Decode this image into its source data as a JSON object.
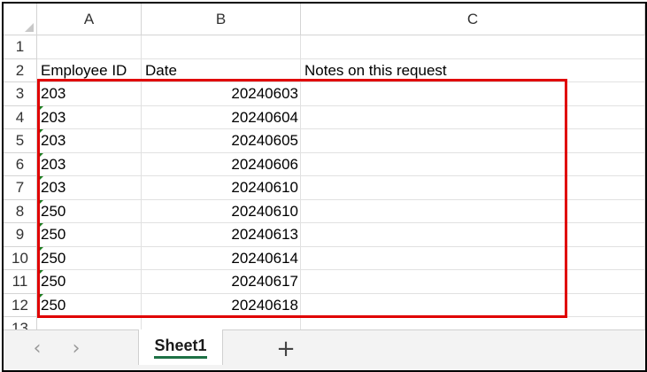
{
  "columns": [
    "A",
    "B",
    "C"
  ],
  "row_numbers": [
    "1",
    "2",
    "3",
    "4",
    "5",
    "6",
    "7",
    "8",
    "9",
    "10",
    "11",
    "12",
    "13"
  ],
  "rows": [
    {
      "a": "",
      "b": "",
      "c": "",
      "flag": false
    },
    {
      "a": "Employee ID",
      "b": "Date",
      "c": "Notes on this request",
      "flag": false
    },
    {
      "a": "203",
      "b": "20240603",
      "c": "",
      "flag": false
    },
    {
      "a": "203",
      "b": "20240604",
      "c": "",
      "flag": true
    },
    {
      "a": "203",
      "b": "20240605",
      "c": "",
      "flag": true
    },
    {
      "a": "203",
      "b": "20240606",
      "c": "",
      "flag": true
    },
    {
      "a": "203",
      "b": "20240610",
      "c": "",
      "flag": true
    },
    {
      "a": "250",
      "b": "20240610",
      "c": "",
      "flag": true
    },
    {
      "a": "250",
      "b": "20240613",
      "c": "",
      "flag": true
    },
    {
      "a": "250",
      "b": "20240614",
      "c": "",
      "flag": true
    },
    {
      "a": "250",
      "b": "20240617",
      "c": "",
      "flag": true
    },
    {
      "a": "250",
      "b": "20240618",
      "c": "",
      "flag": true
    },
    {
      "a": "",
      "b": "",
      "c": "",
      "flag": false
    }
  ],
  "tabbar": {
    "prev_icon": "chevron-left-icon",
    "next_icon": "chevron-right-icon",
    "sheet_tab": "Sheet1",
    "add_icon": "plus-icon"
  },
  "colors": {
    "highlight_border": "#e00000",
    "error_indicator": "#1f7a1f",
    "active_tab_underline": "#1e7145"
  }
}
